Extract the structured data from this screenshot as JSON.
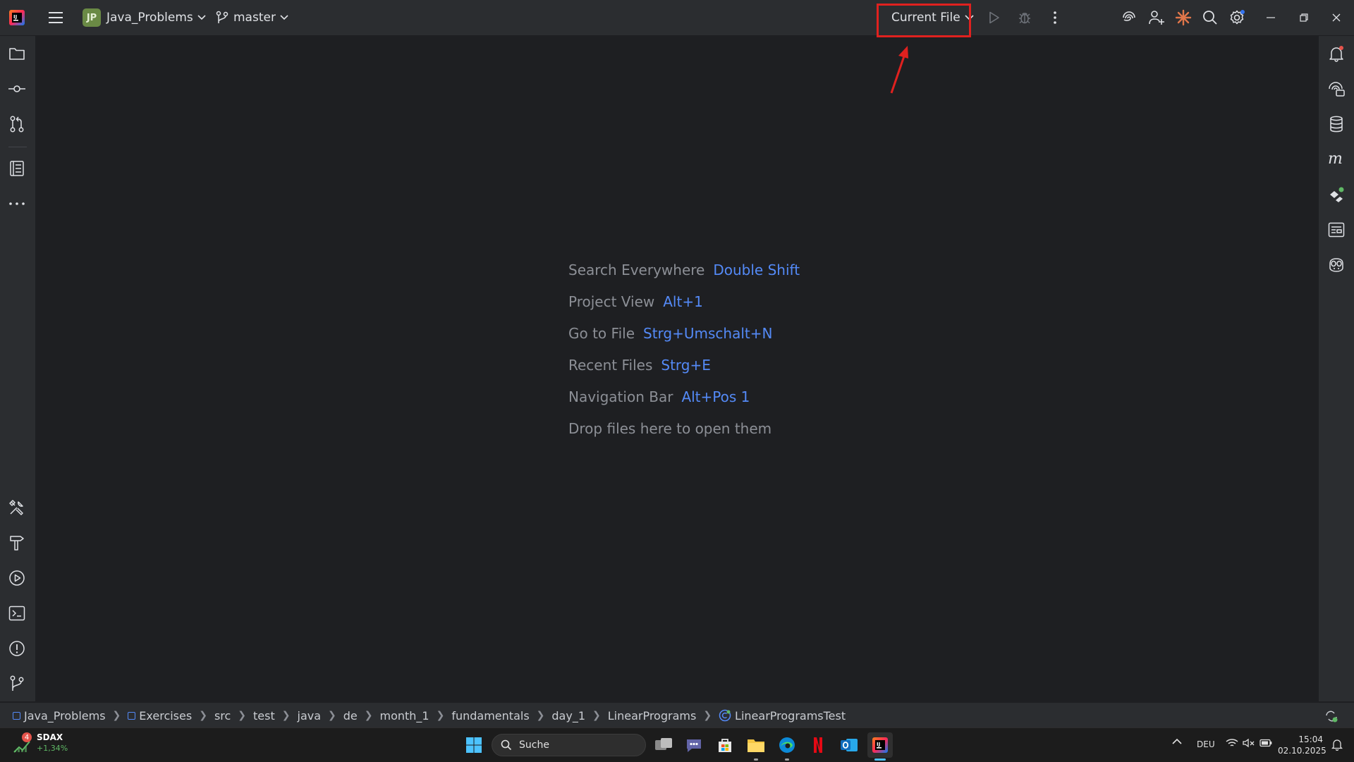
{
  "titlebar": {
    "project_initials": "JP",
    "project_name": "Java_Problems",
    "branch": "master",
    "run_config": "Current File"
  },
  "left_stripe": {
    "icons": [
      "project-folder-icon",
      "commit-icon",
      "pull-requests-icon",
      "structure-icon",
      "more-icon",
      "services-icon",
      "build-icon",
      "run-icon",
      "terminal-icon",
      "problems-icon",
      "git-icon"
    ]
  },
  "right_stripe": {
    "icons": [
      "notifications-icon",
      "ai-assistant-icon",
      "database-icon",
      "maven-icon",
      "coverage-icon",
      "word-icon",
      "copilot-icon"
    ]
  },
  "editor": {
    "hints": [
      {
        "label": "Search Everywhere",
        "key": "Double Shift"
      },
      {
        "label": "Project View",
        "key": "Alt+1"
      },
      {
        "label": "Go to File",
        "key": "Strg+Umschalt+N"
      },
      {
        "label": "Recent Files",
        "key": "Strg+E"
      },
      {
        "label": "Navigation Bar",
        "key": "Alt+Pos 1"
      }
    ],
    "drop_text": "Drop files here to open them"
  },
  "breadcrumb": [
    "Java_Problems",
    "Exercises",
    "src",
    "test",
    "java",
    "de",
    "month_1",
    "fundamentals",
    "day_1",
    "LinearPrograms",
    "LinearProgramsTest"
  ],
  "taskbar": {
    "stock_badge": "4",
    "stock_name": "SDAX",
    "stock_change": "+1,34%",
    "search_placeholder": "Suche",
    "language": "DEU",
    "time": "15:04",
    "date": "02.10.2025"
  },
  "colors": {
    "accent": "#548af7",
    "annotation": "#e0211f",
    "background": "#1e1f22",
    "panel": "#2b2d30"
  }
}
